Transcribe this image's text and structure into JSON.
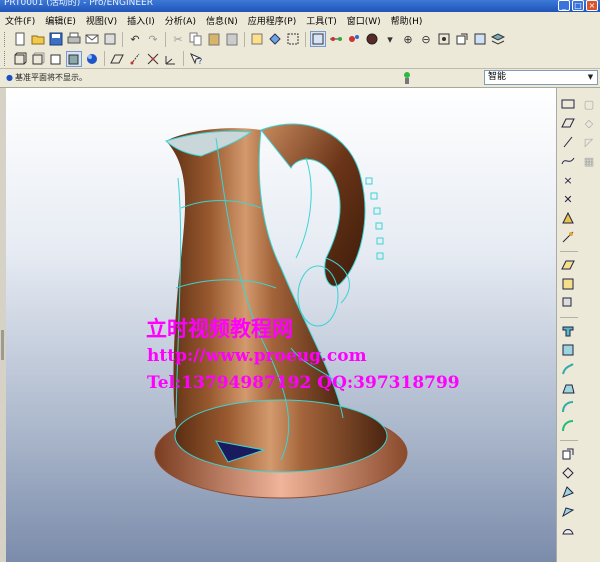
{
  "window": {
    "title": "PRT0001 (活动的) - Pro/ENGINEER",
    "buttons": [
      "_",
      "□",
      "×"
    ]
  },
  "menu": [
    "文件(F)",
    "编辑(E)",
    "视图(V)",
    "插入(I)",
    "分析(A)",
    "信息(N)",
    "应用程序(P)",
    "工具(T)",
    "窗口(W)",
    "帮助(H)"
  ],
  "toolbar1": {
    "icons": [
      "new-icon",
      "open-icon",
      "save-icon",
      "print-icon",
      "email-icon",
      "send-icon",
      "undo-icon",
      "redo-icon",
      "cut-icon",
      "copy-icon",
      "paste-icon",
      "paste-special-icon",
      "regenerate-icon",
      "regen-manager-icon",
      "select-box-icon",
      "datum-axis-icon",
      "plane-display-icon",
      "axis-display-icon",
      "point-display-icon",
      "csys-display-icon",
      "appearance-icon",
      "zoom-in-icon",
      "zoom-out-icon",
      "refit-icon",
      "reorient-icon",
      "view-manager-icon",
      "layers-icon"
    ]
  },
  "toolbar2": {
    "icons": [
      "wireframe-icon",
      "hidden-line-icon",
      "no-hidden-icon",
      "shading-icon",
      "enhanced-realism-icon",
      "datum-plane-icon",
      "datum-axis-tool-icon",
      "datum-point-icon",
      "csys-tool-icon",
      "help-whats-this-icon"
    ]
  },
  "status": {
    "message": "基准平面将不显示。",
    "filter_value": "智能"
  },
  "watermark": {
    "line1": "立时视频教程网",
    "line2": "http://www.proeug.com",
    "line3": "Tel:13794987192  QQ:397318799"
  },
  "right_toolbar": {
    "col1": [
      "plane-tool-icon",
      "sketch-tool-icon",
      "axis-tool-icon",
      "curve-tool-icon",
      "point-tool-icon",
      "csys-tool-icon",
      "analysis-icon",
      "fixture-icon",
      "sketch-datum-icon",
      "style-icon",
      "replace-icon",
      "extrude-icon",
      "revolve-icon",
      "sweep-icon",
      "blend-icon",
      "hole-icon",
      "round-icon",
      "chamfer-icon",
      "draft-icon",
      "shell-icon",
      "rib-icon",
      "pattern-icon",
      "mirror-icon",
      "merge-icon"
    ],
    "col2": [
      "dim-icon-1",
      "dim-icon-2",
      "dim-icon-3",
      "dim-icon-4"
    ]
  }
}
